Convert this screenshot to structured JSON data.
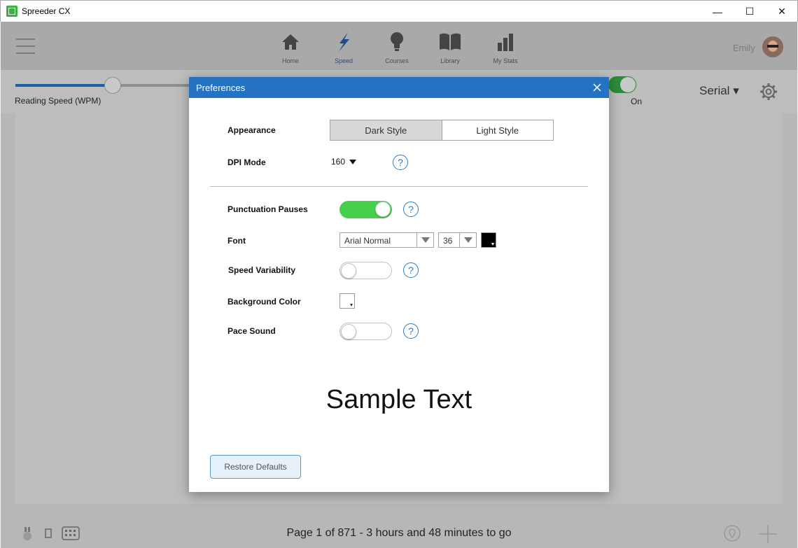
{
  "window": {
    "title": "Spreeder CX",
    "icon": "app-icon",
    "controls": {
      "minimize": "—",
      "maximize": "☐",
      "close": "✕"
    }
  },
  "nav": {
    "items": [
      {
        "id": "home",
        "label": "Home",
        "icon": "home-icon"
      },
      {
        "id": "speed",
        "label": "Speed",
        "icon": "lightning-icon",
        "active": true
      },
      {
        "id": "courses",
        "label": "Courses",
        "icon": "lightbulb-icon"
      },
      {
        "id": "library",
        "label": "Library",
        "icon": "book-icon"
      },
      {
        "id": "stats",
        "label": "My Stats",
        "icon": "bar-chart-icon"
      }
    ],
    "user": {
      "name": "Emily"
    }
  },
  "controls": {
    "speed_label": "Reading Speed (WPM)",
    "speed_fraction": 0.53,
    "toggle_label": "On",
    "toggle_on": true,
    "mode": "Serial",
    "mode_caret": "▾"
  },
  "status": {
    "text": "Page 1 of 871 - 3 hours and 48 minutes to go"
  },
  "dialog": {
    "title": "Preferences",
    "close": "✕",
    "appearance": {
      "label": "Appearance",
      "options": [
        "Dark Style",
        "Light Style"
      ],
      "selected": "Dark Style"
    },
    "dpi": {
      "label": "DPI Mode",
      "value": "160"
    },
    "help_glyph": "?",
    "punctuation": {
      "label": "Punctuation Pauses",
      "on": true
    },
    "font": {
      "label": "Font",
      "family": "Arial Normal",
      "size": "36",
      "color": "#000000"
    },
    "variability": {
      "label": "Speed Variability",
      "on": false
    },
    "background": {
      "label": "Background Color",
      "color": "#ffffff"
    },
    "pace": {
      "label": "Pace Sound",
      "on": false
    },
    "sample_text": "Sample Text",
    "restore_label": "Restore Defaults"
  },
  "colors": {
    "accent": "#2473c2",
    "toggle_on": "#46d04b",
    "help": "#2a7bc4"
  }
}
